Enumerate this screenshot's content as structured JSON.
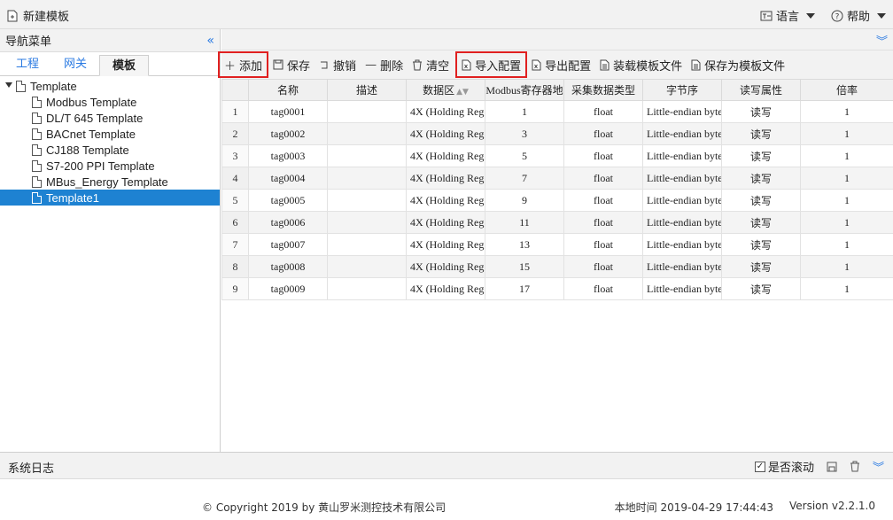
{
  "topbar": {
    "new_template": "新建模板",
    "language": "语言",
    "help": "帮助"
  },
  "nav": {
    "title": "导航菜单",
    "tabs": [
      "工程",
      "网关",
      "模板"
    ],
    "tree_root": "Template",
    "tree_items": [
      "Modbus Template",
      "DL/T 645 Template",
      "BACnet Template",
      "CJ188 Template",
      "S7-200 PPI Template",
      "MBus_Energy Template",
      "Template1"
    ]
  },
  "toolbar": {
    "add": "添加",
    "save": "保存",
    "undo": "撤销",
    "delete": "删除",
    "clear": "清空",
    "import": "导入配置",
    "export": "导出配置",
    "load": "装载模板文件",
    "save_as": "保存为模板文件"
  },
  "table": {
    "headers": [
      "名称",
      "描述",
      "数据区",
      "Modbus寄存器地",
      "采集数据类型",
      "字节序",
      "读写属性",
      "倍率"
    ],
    "rows": [
      {
        "n": "1",
        "name": "tag0001",
        "desc": "",
        "area": "4X (Holding Reg",
        "addr": "1",
        "type": "float",
        "order": "Little-endian byte",
        "rw": "读写",
        "rate": "1"
      },
      {
        "n": "2",
        "name": "tag0002",
        "desc": "",
        "area": "4X (Holding Reg",
        "addr": "3",
        "type": "float",
        "order": "Little-endian byte",
        "rw": "读写",
        "rate": "1"
      },
      {
        "n": "3",
        "name": "tag0003",
        "desc": "",
        "area": "4X (Holding Reg",
        "addr": "5",
        "type": "float",
        "order": "Little-endian byte",
        "rw": "读写",
        "rate": "1"
      },
      {
        "n": "4",
        "name": "tag0004",
        "desc": "",
        "area": "4X (Holding Reg",
        "addr": "7",
        "type": "float",
        "order": "Little-endian byte",
        "rw": "读写",
        "rate": "1"
      },
      {
        "n": "5",
        "name": "tag0005",
        "desc": "",
        "area": "4X (Holding Reg",
        "addr": "9",
        "type": "float",
        "order": "Little-endian byte",
        "rw": "读写",
        "rate": "1"
      },
      {
        "n": "6",
        "name": "tag0006",
        "desc": "",
        "area": "4X (Holding Reg",
        "addr": "11",
        "type": "float",
        "order": "Little-endian byte",
        "rw": "读写",
        "rate": "1"
      },
      {
        "n": "7",
        "name": "tag0007",
        "desc": "",
        "area": "4X (Holding Reg",
        "addr": "13",
        "type": "float",
        "order": "Little-endian byte",
        "rw": "读写",
        "rate": "1"
      },
      {
        "n": "8",
        "name": "tag0008",
        "desc": "",
        "area": "4X (Holding Reg",
        "addr": "15",
        "type": "float",
        "order": "Little-endian byte",
        "rw": "读写",
        "rate": "1"
      },
      {
        "n": "9",
        "name": "tag0009",
        "desc": "",
        "area": "4X (Holding Reg",
        "addr": "17",
        "type": "float",
        "order": "Little-endian byte",
        "rw": "读写",
        "rate": "1"
      }
    ]
  },
  "log": {
    "title": "系统日志",
    "autoscroll": "是否滚动"
  },
  "footer": {
    "copyright": "© Copyright 2019 by 黄山罗米测控技术有限公司",
    "time_label": "本地时间",
    "time_value": "2019-04-29 17:44:43",
    "version": "Version v2.2.1.0"
  }
}
